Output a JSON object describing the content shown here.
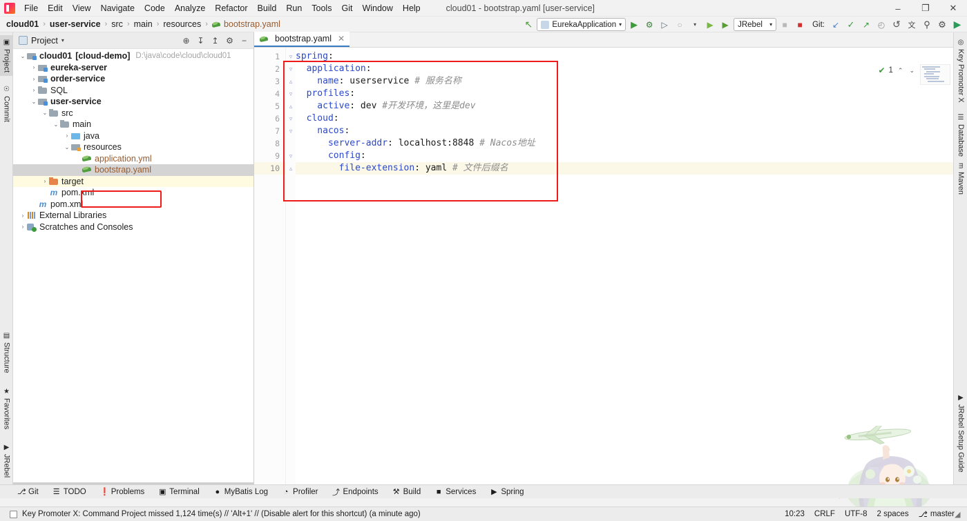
{
  "window": {
    "title": "cloud01 - bootstrap.yaml [user-service]",
    "minimize": "–",
    "maximize": "❐",
    "close": "✕"
  },
  "menubar": {
    "items": [
      {
        "label": "File"
      },
      {
        "label": "Edit"
      },
      {
        "label": "View"
      },
      {
        "label": "Navigate"
      },
      {
        "label": "Code"
      },
      {
        "label": "Analyze"
      },
      {
        "label": "Refactor"
      },
      {
        "label": "Build"
      },
      {
        "label": "Run"
      },
      {
        "label": "Tools"
      },
      {
        "label": "Git"
      },
      {
        "label": "Window"
      },
      {
        "label": "Help"
      }
    ]
  },
  "breadcrumb": {
    "items": [
      {
        "label": "cloud01",
        "bold": true,
        "file": false
      },
      {
        "label": "user-service",
        "bold": true,
        "file": false
      },
      {
        "label": "src",
        "bold": false,
        "file": false
      },
      {
        "label": "main",
        "bold": false,
        "file": false
      },
      {
        "label": "resources",
        "bold": false,
        "file": false
      },
      {
        "label": "bootstrap.yaml",
        "bold": false,
        "file": true
      }
    ],
    "separator": "›"
  },
  "toolbar": {
    "back_icon": "↖",
    "run_config": "EurekaApplication",
    "run_icon": "▶",
    "debug_icon": "⚙",
    "run_coverage_icon": "▷",
    "profile_icon": "○",
    "profile_caret": "▾",
    "jrebel_run_icon": "▶",
    "jrebel_debug_icon": "▶",
    "jrebel_config": "JRebel",
    "stop_icon": "■",
    "stop2_icon": "■",
    "git_label": "Git:",
    "git_update_icon": "↙",
    "git_commit_icon": "✓",
    "git_push_icon": "↗",
    "git_history_icon": "◴",
    "undo_icon": "↺",
    "translate_icon": "文",
    "search_icon": "⚲",
    "settings_icon": "⚙",
    "play_icon": "▶",
    "caret": "▾"
  },
  "left_strip": {
    "top": [
      {
        "label": "Project",
        "icon": "▣",
        "active": true
      },
      {
        "label": "Commit",
        "icon": "☉",
        "active": false
      }
    ],
    "bottom": [
      {
        "label": "Structure",
        "icon": "▤",
        "active": false
      },
      {
        "label": "Favorites",
        "icon": "★",
        "active": false
      },
      {
        "label": "JRebel",
        "icon": "▶",
        "active": false
      }
    ]
  },
  "right_strip": {
    "top": [
      {
        "label": "Key Promoter X",
        "icon": "◎"
      },
      {
        "label": "Database",
        "icon": "☰"
      },
      {
        "label": "Maven",
        "icon": "m"
      }
    ],
    "bottom": [
      {
        "label": "JRebel Setup Guide",
        "icon": "▶"
      }
    ]
  },
  "project_panel": {
    "title": "Project",
    "caret": "▾",
    "actions": [
      {
        "name": "locate-icon",
        "glyph": "⊕"
      },
      {
        "name": "expand-all-icon",
        "glyph": "↧"
      },
      {
        "name": "collapse-all-icon",
        "glyph": "↥"
      },
      {
        "name": "settings-icon",
        "glyph": "⚙"
      },
      {
        "name": "hide-icon",
        "glyph": "−"
      }
    ],
    "tree": [
      {
        "label": "cloud01",
        "badge": "[cloud-demo]",
        "path": "D:\\java\\code\\cloud\\cloud01",
        "indent": 0,
        "arrow": "⌄",
        "icon": "ic-module",
        "bold": true,
        "selected": false,
        "highlight": false,
        "filetype": ""
      },
      {
        "label": "eureka-server",
        "badge": "",
        "path": "",
        "indent": 1,
        "arrow": "›",
        "icon": "ic-module",
        "bold": true,
        "selected": false,
        "highlight": false,
        "filetype": ""
      },
      {
        "label": "order-service",
        "badge": "",
        "path": "",
        "indent": 1,
        "arrow": "›",
        "icon": "ic-module",
        "bold": true,
        "selected": false,
        "highlight": false,
        "filetype": ""
      },
      {
        "label": "SQL",
        "badge": "",
        "path": "",
        "indent": 1,
        "arrow": "›",
        "icon": "ic-folder",
        "bold": false,
        "selected": false,
        "highlight": false,
        "filetype": ""
      },
      {
        "label": "user-service",
        "badge": "",
        "path": "",
        "indent": 1,
        "arrow": "⌄",
        "icon": "ic-module",
        "bold": true,
        "selected": false,
        "highlight": false,
        "filetype": ""
      },
      {
        "label": "src",
        "badge": "",
        "path": "",
        "indent": 2,
        "arrow": "⌄",
        "icon": "ic-src",
        "bold": false,
        "selected": false,
        "highlight": false,
        "filetype": ""
      },
      {
        "label": "main",
        "badge": "",
        "path": "",
        "indent": 3,
        "arrow": "⌄",
        "icon": "ic-src",
        "bold": false,
        "selected": false,
        "highlight": false,
        "filetype": ""
      },
      {
        "label": "java",
        "badge": "",
        "path": "",
        "indent": 4,
        "arrow": "›",
        "icon": "ic-java",
        "bold": false,
        "selected": false,
        "highlight": false,
        "filetype": ""
      },
      {
        "label": "resources",
        "badge": "",
        "path": "",
        "indent": 4,
        "arrow": "⌄",
        "icon": "ic-res",
        "bold": false,
        "selected": false,
        "highlight": false,
        "filetype": ""
      },
      {
        "label": "application.yml",
        "badge": "",
        "path": "",
        "indent": 5,
        "arrow": "",
        "icon": "ic-yaml",
        "bold": false,
        "selected": false,
        "highlight": false,
        "filetype": "yaml"
      },
      {
        "label": "bootstrap.yaml",
        "badge": "",
        "path": "",
        "indent": 5,
        "arrow": "",
        "icon": "ic-yaml",
        "bold": false,
        "selected": true,
        "highlight": false,
        "filetype": "yaml"
      },
      {
        "label": "target",
        "badge": "",
        "path": "",
        "indent": 2,
        "arrow": "›",
        "icon": "ic-target",
        "bold": false,
        "selected": false,
        "highlight": true,
        "filetype": ""
      },
      {
        "label": "pom.xml",
        "badge": "",
        "path": "",
        "indent": 2,
        "arrow": "",
        "icon": "ic-maven",
        "bold": false,
        "selected": false,
        "highlight": false,
        "filetype": ""
      },
      {
        "label": "pom.xml",
        "badge": "",
        "path": "",
        "indent": 1,
        "arrow": "",
        "icon": "ic-maven",
        "bold": false,
        "selected": false,
        "highlight": false,
        "filetype": ""
      },
      {
        "label": "External Libraries",
        "badge": "",
        "path": "",
        "indent": 0,
        "arrow": "›",
        "icon": "ic-lib",
        "bold": false,
        "selected": false,
        "highlight": false,
        "filetype": ""
      },
      {
        "label": "Scratches and Consoles",
        "badge": "",
        "path": "",
        "indent": 0,
        "arrow": "›",
        "icon": "ic-scratch",
        "bold": false,
        "selected": false,
        "highlight": false,
        "filetype": ""
      }
    ]
  },
  "editor": {
    "tab": {
      "label": "bootstrap.yaml",
      "close": "✕"
    },
    "inspection": {
      "count": "1",
      "check": "✔",
      "up": "⌃",
      "down": "⌄"
    },
    "lines": [
      {
        "num": "1",
        "fold": "▿",
        "current": false,
        "tokens": [
          {
            "t": "spring",
            "c": "k"
          },
          {
            "t": ":",
            "c": "v"
          }
        ]
      },
      {
        "num": "2",
        "fold": "▿",
        "current": false,
        "tokens": [
          {
            "t": "  application",
            "c": "k"
          },
          {
            "t": ":",
            "c": "v"
          }
        ]
      },
      {
        "num": "3",
        "fold": "▵",
        "current": false,
        "tokens": [
          {
            "t": "    name",
            "c": "k"
          },
          {
            "t": ": userservice ",
            "c": "v"
          },
          {
            "t": "# 服务名称",
            "c": "cm"
          }
        ]
      },
      {
        "num": "4",
        "fold": "▿",
        "current": false,
        "tokens": [
          {
            "t": "  profiles",
            "c": "k"
          },
          {
            "t": ":",
            "c": "v"
          }
        ]
      },
      {
        "num": "5",
        "fold": "▵",
        "current": false,
        "tokens": [
          {
            "t": "    active",
            "c": "k"
          },
          {
            "t": ": dev ",
            "c": "v"
          },
          {
            "t": "#开发环境，这里是dev",
            "c": "cm"
          }
        ]
      },
      {
        "num": "6",
        "fold": "▿",
        "current": false,
        "tokens": [
          {
            "t": "  cloud",
            "c": "k"
          },
          {
            "t": ":",
            "c": "v"
          }
        ]
      },
      {
        "num": "7",
        "fold": "▿",
        "current": false,
        "tokens": [
          {
            "t": "    nacos",
            "c": "k"
          },
          {
            "t": ":",
            "c": "v"
          }
        ]
      },
      {
        "num": "8",
        "fold": "",
        "current": false,
        "tokens": [
          {
            "t": "      server-addr",
            "c": "k"
          },
          {
            "t": ": localhost:8848 ",
            "c": "v"
          },
          {
            "t": "# Nacos地址",
            "c": "cm"
          }
        ]
      },
      {
        "num": "9",
        "fold": "▿",
        "current": false,
        "tokens": [
          {
            "t": "      config",
            "c": "k"
          },
          {
            "t": ":",
            "c": "v"
          }
        ]
      },
      {
        "num": "10",
        "fold": "▵",
        "current": true,
        "tokens": [
          {
            "t": "        file-extension",
            "c": "k"
          },
          {
            "t": ": yaml ",
            "c": "v"
          },
          {
            "t": "# 文件后缀名",
            "c": "cm"
          }
        ]
      }
    ]
  },
  "toolwindow_bar": {
    "items": [
      {
        "label": "Git",
        "icon": "⎇"
      },
      {
        "label": "TODO",
        "icon": "☰"
      },
      {
        "label": "Problems",
        "icon": "❗"
      },
      {
        "label": "Terminal",
        "icon": "▣"
      },
      {
        "label": "MyBatis Log",
        "icon": "●"
      },
      {
        "label": "Profiler",
        "icon": "◔"
      },
      {
        "label": "Endpoints",
        "icon": "⤴"
      },
      {
        "label": "Build",
        "icon": "⚒"
      },
      {
        "label": "Services",
        "icon": "■"
      },
      {
        "label": "Spring",
        "icon": "▶"
      }
    ]
  },
  "statusbar": {
    "message": "Key Promoter X: Command Project missed 1,124 time(s) // 'Alt+1' // (Disable alert for this shortcut) (a minute ago)",
    "right": [
      {
        "label": "10:23",
        "name": "clock"
      },
      {
        "label": "CRLF",
        "name": "line-separator"
      },
      {
        "label": "UTF-8",
        "name": "encoding"
      },
      {
        "label": "2 spaces",
        "name": "indent"
      },
      {
        "label": "master",
        "name": "git-branch",
        "icon": "⎇"
      }
    ],
    "grip": "◢"
  },
  "colors": {
    "annotation_red": "#ee1b1b",
    "accent_blue": "#2a48c8",
    "file_brown": "#9a5b2e",
    "tab_underline": "#3a7cc4",
    "highlight_yellow": "#fffbe0"
  }
}
